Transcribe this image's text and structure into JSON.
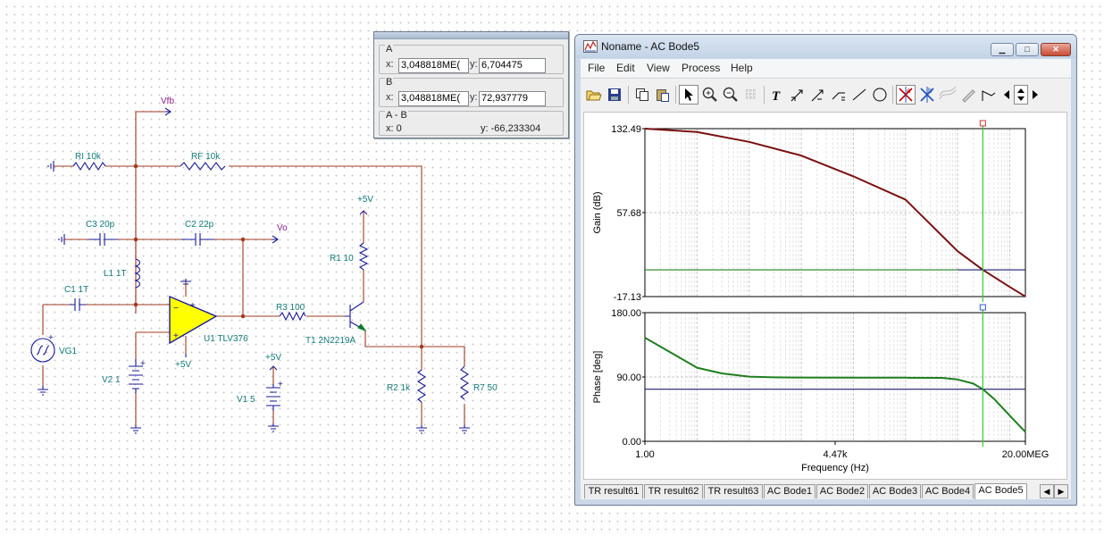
{
  "schematic": {
    "components": {
      "vfb": "Vfb",
      "ri": "RI 10k",
      "rf": "RF 10k",
      "c3": "C3 20p",
      "c2": "C2 22p",
      "vo": "Vo",
      "l1": "L1 1T",
      "c1": "C1 1T",
      "vg1": "VG1",
      "v2": "V2 1",
      "u1": "U1 TLV376",
      "r3": "R3 100",
      "t1": "T1 2N2219A",
      "r1": "R1 10",
      "p5v_top": "+5V",
      "p5v_opamp": "+5V",
      "p5v_v1": "+5V",
      "v1": "V1 5",
      "r2": "R2 1k",
      "r7": "R7 50"
    },
    "colors": {
      "wire": "#a23a1e",
      "component": "#1a1a9a",
      "label": "#127a7a",
      "net_label": "#8b1a8b",
      "opamp_fill": "#ffff00"
    }
  },
  "cursor_panel": {
    "a": {
      "label": "A",
      "x_label": "x:",
      "x_value": "3,048818ME(",
      "y_label": "y:",
      "y_value": "6,704475"
    },
    "b": {
      "label": "B",
      "x_label": "x:",
      "x_value": "3,048818ME(",
      "y_label": "y:",
      "y_value": "72,937779"
    },
    "ab": {
      "label": "A - B",
      "x_text": "x: 0",
      "y_text": "y: -66,233304"
    }
  },
  "window": {
    "title": "Noname - AC Bode5",
    "controls": {
      "minimize": "▁",
      "maximize": "□",
      "close": "✕"
    },
    "menu": [
      "File",
      "Edit",
      "View",
      "Process",
      "Help"
    ],
    "toolbar_icons": [
      "open-icon",
      "save-icon",
      "copy-icon",
      "paste-icon",
      "pointer-icon",
      "zoom-in-icon",
      "zoom-out-icon",
      "grid-icon",
      "text-icon",
      "axis-a-icon",
      "axis-b-icon",
      "axis-c-icon",
      "line-icon",
      "circle-icon",
      "cursor-a-icon",
      "cursor-b-icon",
      "curve-icon",
      "pen-icon",
      "marker-icon",
      "nav-left-icon",
      "nav-up-down-icon",
      "nav-right-icon"
    ],
    "tabs": [
      "TR result61",
      "TR result62",
      "TR result63",
      "AC Bode1",
      "AC Bode2",
      "AC Bode3",
      "AC Bode4",
      "AC Bode5"
    ],
    "active_tab": "AC Bode5",
    "tab_nav": {
      "prev": "◀",
      "next": "▶"
    }
  },
  "chart_data": [
    {
      "type": "line",
      "title": "",
      "xlabel": "Frequency (Hz)",
      "ylabel": "Gain (dB)",
      "xscale": "log",
      "xlim": [
        1,
        20000000
      ],
      "ylim": [
        -17.13,
        132.49
      ],
      "x_ticks": [
        "1.00",
        "4.47k",
        "20.00MEG"
      ],
      "y_ticks": [
        "132.49",
        "57.68",
        "-17.13"
      ],
      "grid": true,
      "cursor_x": 3048818,
      "series": [
        {
          "color": "#7a1010",
          "x": [
            1,
            10,
            100,
            1000,
            10000,
            100000,
            1000000,
            3048818,
            10000000,
            20000000
          ],
          "y": [
            132.5,
            129.5,
            120.7,
            108.5,
            90.0,
            69.3,
            23.3,
            6.7,
            -8.5,
            -17.1
          ]
        },
        {
          "color": "#1f7f1f",
          "x": [
            1,
            1000000
          ],
          "y": [
            6.7,
            6.7
          ]
        },
        {
          "color": "#1f1f6f",
          "x": [
            1000000,
            20000000
          ],
          "y": [
            6.7,
            6.7
          ]
        }
      ]
    },
    {
      "type": "line",
      "title": "",
      "xlabel": "Frequency (Hz)",
      "ylabel": "Phase [deg]",
      "xscale": "log",
      "xlim": [
        1,
        20000000
      ],
      "ylim": [
        0,
        180
      ],
      "x_ticks": [
        "1.00",
        "4.47k",
        "20.00MEG"
      ],
      "y_ticks": [
        "180.00",
        "90.00",
        "0.00"
      ],
      "grid": true,
      "cursor_x": 3048818,
      "series": [
        {
          "color": "#1f7f1f",
          "x": [
            1,
            3,
            10,
            30,
            100,
            300,
            1000,
            10000,
            100000,
            500000,
            1000000,
            2000000,
            3048818,
            5000000,
            10000000,
            20000000
          ],
          "y": [
            145,
            125,
            103,
            95,
            90.5,
            89.5,
            89.2,
            89.0,
            89.0,
            88.7,
            86.5,
            80.8,
            72.9,
            59.4,
            36.0,
            13.0
          ]
        },
        {
          "color": "#1f1f6f",
          "x": [
            1,
            20000000
          ],
          "y": [
            72.9,
            72.9
          ]
        }
      ]
    }
  ]
}
